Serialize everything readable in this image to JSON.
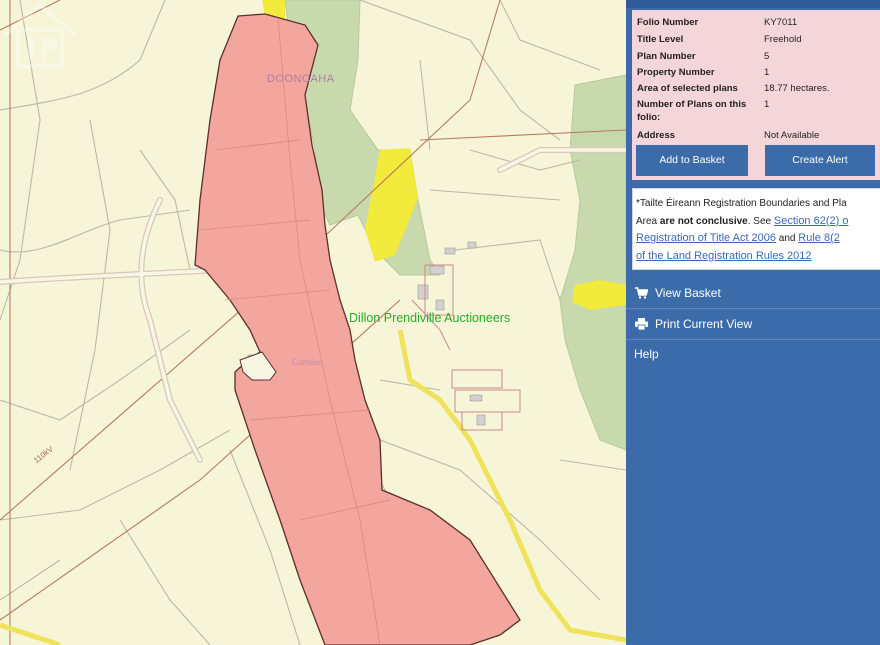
{
  "map": {
    "townland_label": "DOONCAHA",
    "sub_townland_label": "Curheen",
    "watermark": "Dillon Prendiville Auctioneers",
    "powerline_label": "110kV",
    "colors": {
      "background": "#f7f5d7",
      "selected_plan": "#f4a59d",
      "forestry": "#c7d9ad",
      "yellow_plot": "#f4ec3e",
      "road_outline": "#d9b9b0",
      "boundary": "#b9a6a0"
    }
  },
  "folio": {
    "rows": [
      {
        "key": "Folio Number",
        "value": "KY7011"
      },
      {
        "key": "Title Level",
        "value": "Freehold"
      },
      {
        "key": "Plan Number",
        "value": "5"
      },
      {
        "key": "Property Number",
        "value": "1"
      },
      {
        "key": "Area of selected plans",
        "value": "18.77 hectares."
      },
      {
        "key": "Number of Plans on this folio:",
        "value": "1"
      },
      {
        "key": "Address",
        "value": "Not Available"
      }
    ],
    "add_to_basket": "Add to Basket",
    "create_alert": "Create Alert"
  },
  "notice": {
    "line1": "*Tailte Éireann Registration Boundaries and Pla",
    "line2_pre": "Area ",
    "line2_bold": "are not conclusive",
    "line2_mid": ". See ",
    "line2_link": "Section 62(2) o",
    "line3_link": "Registration of Title Act 2006",
    "line3_mid": " and ",
    "line3_link2": "Rule 8(2",
    "line4_link": "of the Land Registration Rules 2012"
  },
  "menu": {
    "view_basket": "View Basket",
    "print_view": "Print Current View",
    "help": "Help",
    "view_basket_icon": "cart-icon",
    "print_icon": "print-icon"
  },
  "panel_color": "#3b6ba8"
}
